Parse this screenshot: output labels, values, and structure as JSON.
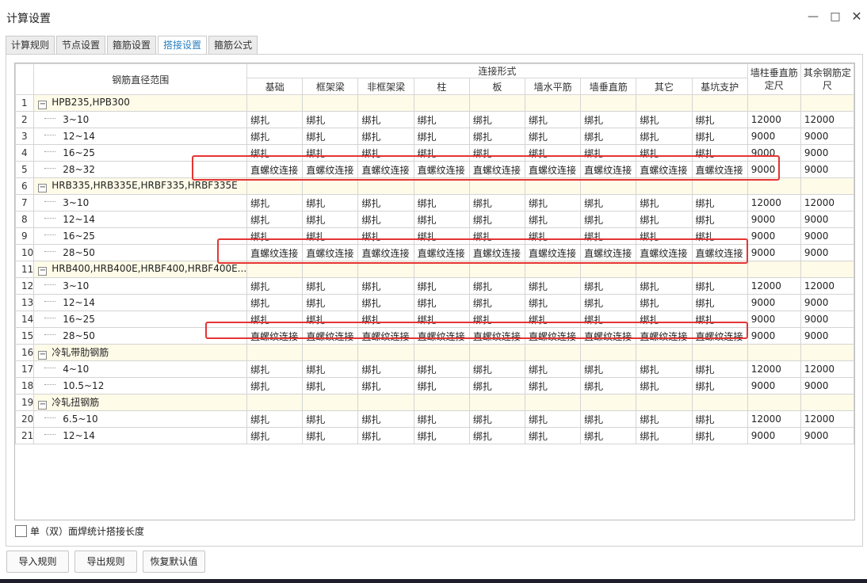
{
  "window": {
    "title": "计算设置"
  },
  "tabs": [
    "计算规则",
    "节点设置",
    "箍筋设置",
    "搭接设置",
    "箍筋公式"
  ],
  "active_tab_index": 3,
  "table": {
    "header": {
      "diameter_range": "钢筋直径范围",
      "connection_type": "连接形式",
      "connection_columns": [
        "基础",
        "框架梁",
        "非框架梁",
        "柱",
        "板",
        "墙水平筋",
        "墙垂直筋",
        "其它",
        "基坑支护"
      ],
      "wall_col_fixed": "墙柱垂直筋定尺",
      "other_fixed": "其余钢筋定尺"
    },
    "rows": [
      {
        "n": "1",
        "group": true,
        "name": "HPB235,HPB300"
      },
      {
        "n": "2",
        "range": "3~10",
        "conn": [
          "绑扎",
          "绑扎",
          "绑扎",
          "绑扎",
          "绑扎",
          "绑扎",
          "绑扎",
          "绑扎",
          "绑扎"
        ],
        "wall": "12000",
        "other": "12000"
      },
      {
        "n": "3",
        "range": "12~14",
        "conn": [
          "绑扎",
          "绑扎",
          "绑扎",
          "绑扎",
          "绑扎",
          "绑扎",
          "绑扎",
          "绑扎",
          "绑扎"
        ],
        "wall": "9000",
        "other": "9000"
      },
      {
        "n": "4",
        "range": "16~25",
        "conn": [
          "绑扎",
          "绑扎",
          "绑扎",
          "绑扎",
          "绑扎",
          "绑扎",
          "绑扎",
          "绑扎",
          "绑扎"
        ],
        "wall": "9000",
        "other": "9000"
      },
      {
        "n": "5",
        "range": "28~32",
        "conn": [
          "直螺纹连接",
          "直螺纹连接",
          "直螺纹连接",
          "直螺纹连接",
          "直螺纹连接",
          "直螺纹连接",
          "直螺纹连接",
          "直螺纹连接",
          "直螺纹连接"
        ],
        "wall": "9000",
        "other": "9000"
      },
      {
        "n": "6",
        "group": true,
        "name": "HRB335,HRB335E,HRBF335,HRBF335E"
      },
      {
        "n": "7",
        "range": "3~10",
        "conn": [
          "绑扎",
          "绑扎",
          "绑扎",
          "绑扎",
          "绑扎",
          "绑扎",
          "绑扎",
          "绑扎",
          "绑扎"
        ],
        "wall": "12000",
        "other": "12000"
      },
      {
        "n": "8",
        "range": "12~14",
        "conn": [
          "绑扎",
          "绑扎",
          "绑扎",
          "绑扎",
          "绑扎",
          "绑扎",
          "绑扎",
          "绑扎",
          "绑扎"
        ],
        "wall": "9000",
        "other": "9000"
      },
      {
        "n": "9",
        "range": "16~25",
        "conn": [
          "绑扎",
          "绑扎",
          "绑扎",
          "绑扎",
          "绑扎",
          "绑扎",
          "绑扎",
          "绑扎",
          "绑扎"
        ],
        "wall": "9000",
        "other": "9000"
      },
      {
        "n": "10",
        "range": "28~50",
        "conn": [
          "直螺纹连接",
          "直螺纹连接",
          "直螺纹连接",
          "直螺纹连接",
          "直螺纹连接",
          "直螺纹连接",
          "直螺纹连接",
          "直螺纹连接",
          "直螺纹连接"
        ],
        "wall": "9000",
        "other": "9000"
      },
      {
        "n": "11",
        "group": true,
        "name": "HRB400,HRB400E,HRBF400,HRBF400E..."
      },
      {
        "n": "12",
        "range": "3~10",
        "conn": [
          "绑扎",
          "绑扎",
          "绑扎",
          "绑扎",
          "绑扎",
          "绑扎",
          "绑扎",
          "绑扎",
          "绑扎"
        ],
        "wall": "12000",
        "other": "12000"
      },
      {
        "n": "13",
        "range": "12~14",
        "conn": [
          "绑扎",
          "绑扎",
          "绑扎",
          "绑扎",
          "绑扎",
          "绑扎",
          "绑扎",
          "绑扎",
          "绑扎"
        ],
        "wall": "9000",
        "other": "9000"
      },
      {
        "n": "14",
        "range": "16~25",
        "conn": [
          "绑扎",
          "绑扎",
          "绑扎",
          "绑扎",
          "绑扎",
          "绑扎",
          "绑扎",
          "绑扎",
          "绑扎"
        ],
        "wall": "9000",
        "other": "9000"
      },
      {
        "n": "15",
        "range": "28~50",
        "conn": [
          "直螺纹连接",
          "直螺纹连接",
          "直螺纹连接",
          "直螺纹连接",
          "直螺纹连接",
          "直螺纹连接",
          "直螺纹连接",
          "直螺纹连接",
          "直螺纹连接"
        ],
        "wall": "9000",
        "other": "9000"
      },
      {
        "n": "16",
        "group": true,
        "name": "冷轧带肋钢筋"
      },
      {
        "n": "17",
        "range": "4~10",
        "conn": [
          "绑扎",
          "绑扎",
          "绑扎",
          "绑扎",
          "绑扎",
          "绑扎",
          "绑扎",
          "绑扎",
          "绑扎"
        ],
        "wall": "12000",
        "other": "12000"
      },
      {
        "n": "18",
        "range": "10.5~12",
        "conn": [
          "绑扎",
          "绑扎",
          "绑扎",
          "绑扎",
          "绑扎",
          "绑扎",
          "绑扎",
          "绑扎",
          "绑扎"
        ],
        "wall": "9000",
        "other": "9000"
      },
      {
        "n": "19",
        "group": true,
        "name": "冷轧扭钢筋"
      },
      {
        "n": "20",
        "range": "6.5~10",
        "conn": [
          "绑扎",
          "绑扎",
          "绑扎",
          "绑扎",
          "绑扎",
          "绑扎",
          "绑扎",
          "绑扎",
          "绑扎"
        ],
        "wall": "12000",
        "other": "12000"
      },
      {
        "n": "21",
        "range": "12~14",
        "conn": [
          "绑扎",
          "绑扎",
          "绑扎",
          "绑扎",
          "绑扎",
          "绑扎",
          "绑扎",
          "绑扎",
          "绑扎"
        ],
        "wall": "9000",
        "other": "9000"
      }
    ]
  },
  "checkbox": {
    "label": "单（双）面焊统计搭接长度",
    "checked": false
  },
  "buttons": {
    "import": "导入规则",
    "export": "导出规则",
    "restore": "恢复默认值"
  },
  "icons": {
    "minimize": "minimize-icon",
    "maximize": "maximize-icon",
    "close": "close-icon",
    "collapse": "collapse-icon"
  },
  "colors": {
    "highlight": "#e53535",
    "group_row_bg": "#fefbe8",
    "active_tab_text": "#2a7fc0"
  }
}
